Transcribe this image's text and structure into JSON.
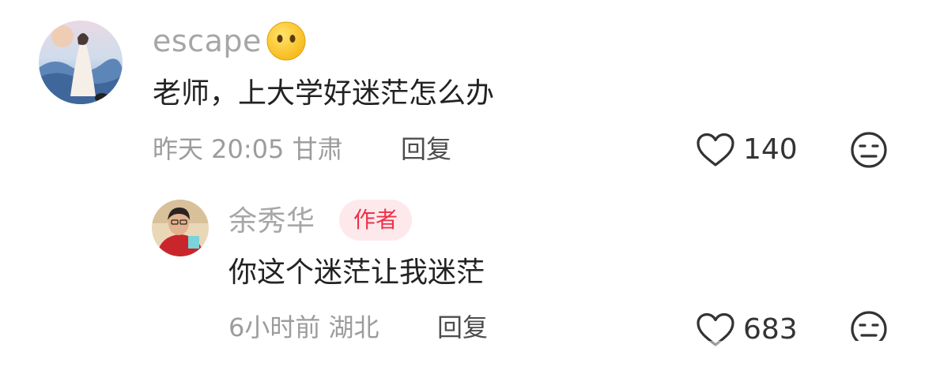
{
  "comment": {
    "username": "escape",
    "text": "老师，上大学好迷茫怎么办",
    "time": "昨天 20:05",
    "location": "甘肃",
    "reply_label": "回复",
    "likes": "140"
  },
  "reply": {
    "username": "余秀华",
    "badge": "作者",
    "text": "你这个迷茫让我迷茫",
    "time": "6小时前",
    "location": "湖北",
    "reply_label": "回复",
    "likes": "683"
  },
  "icons": {
    "like": "heart-outline-icon",
    "dislike": "neutral-face-icon",
    "username_emoji": "no-mouth-emoji-icon"
  },
  "colors": {
    "badge_bg": "#fde9ec",
    "badge_text": "#f0304a",
    "username": "#a6a6a6",
    "meta": "#9c9c9c"
  }
}
